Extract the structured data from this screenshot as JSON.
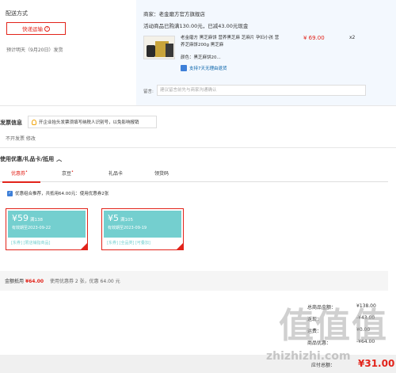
{
  "delivery": {
    "title": "配送方式",
    "option_label": "快递运输",
    "estimate": "预计明天（9月20日）发货"
  },
  "order": {
    "shop": "商家：老金磨方官方旗舰店",
    "promo": "活动商品已购满130.00元，已减43.00元现金",
    "product_name": "老金磨方 黑芝麻饼 营养黑芝麻 芝麻片 孕妇小孩 营养芝麻饼200g 黑芝麻",
    "price": "¥ 69.00",
    "qty": "x2",
    "spec": "颜色：黑芝麻饼20...",
    "service": "支持7天无理由退货",
    "message_label": "留言:",
    "message_placeholder": "建议留言前先与商家沟通确认"
  },
  "invoice": {
    "title": "发票信息",
    "tip": "开企业抬头发票须填写纳税人识别号，以免影响报销",
    "value": "不开发票 修改"
  },
  "coupons": {
    "title": "使用优惠/礼品卡/抵用",
    "tabs": [
      {
        "label": "优惠券",
        "dot": "•"
      },
      {
        "label": "京豆",
        "dot": "•"
      },
      {
        "label": "礼品卡",
        "dot": ""
      },
      {
        "label": "领货码",
        "dot": ""
      }
    ],
    "checkbox_text": "优惠组合推荐，共抵用64.00元：使用优惠券2张",
    "cards": [
      {
        "amount": "¥59",
        "cond": "满138",
        "expiry": "有效期至2023-09-22",
        "tags": "[东券] [限店铺指商品]"
      },
      {
        "amount": "¥5",
        "cond": "满105",
        "expiry": "有效期至2023-09-19",
        "tags": "[东券] [全品类] [可叠加]"
      }
    ],
    "total_label": "金额抵用",
    "total_amount": "¥64.00",
    "total_note": "使用优惠券 2 张，优惠 64.00 元"
  },
  "summary": {
    "rows": [
      {
        "label": "总商品金额：",
        "value": "¥138.00"
      },
      {
        "label": "返现：",
        "value": "-¥43.00"
      },
      {
        "label": "运费：",
        "value": "¥0.00"
      },
      {
        "label": "商品优惠：",
        "value": "-¥64.00"
      }
    ],
    "pay_label": "应付总额：",
    "pay_amount": "¥31.00"
  },
  "watermark": {
    "logo": "值值值",
    "site": "zhizhizhi.com"
  },
  "colors": {
    "accent": "#e2231a",
    "coupon": "#74cfcf",
    "link": "#005ea7"
  }
}
